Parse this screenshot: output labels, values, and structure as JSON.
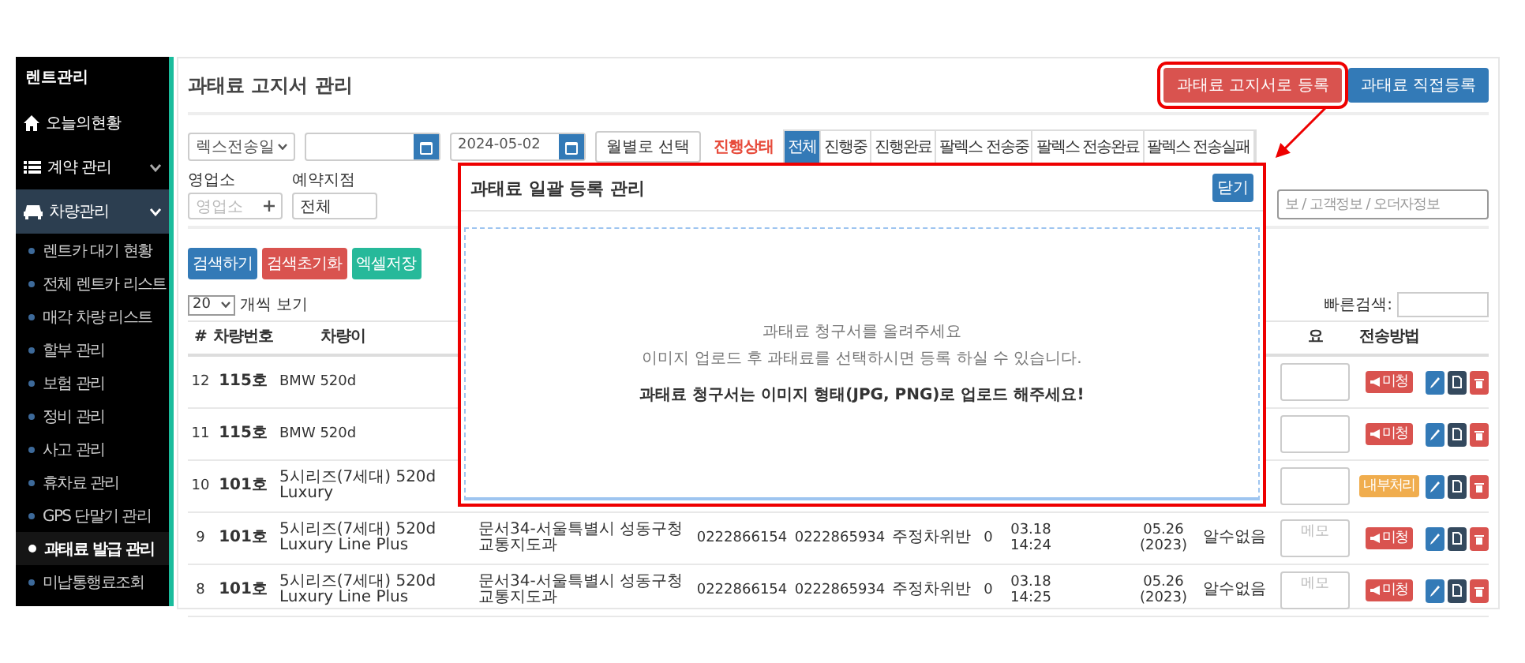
{
  "sidebar": {
    "title": "렌트관리",
    "items": [
      {
        "kind": "link",
        "label": "오늘의현황"
      },
      {
        "kind": "group",
        "label": "계약 관리",
        "expanded": false
      },
      {
        "kind": "group",
        "label": "차량관리",
        "expanded": true,
        "children": [
          {
            "label": "렌트카 대기 현황",
            "selected": false
          },
          {
            "label": "전체 렌트카 리스트",
            "selected": false
          },
          {
            "label": "매각 차량 리스트",
            "selected": false
          },
          {
            "label": "할부 관리",
            "selected": false
          },
          {
            "label": "보험 관리",
            "selected": false
          },
          {
            "label": "정비 관리",
            "selected": false
          },
          {
            "label": "사고 관리",
            "selected": false
          },
          {
            "label": "휴차료 관리",
            "selected": false
          },
          {
            "label": "GPS 단말기 관리",
            "selected": false
          },
          {
            "label": "과태료 발급 관리",
            "selected": true
          },
          {
            "label": "미납통행료조회",
            "selected": false
          }
        ]
      }
    ]
  },
  "header": {
    "title": "과태료 고지서 관리",
    "buttons": [
      {
        "label": "과태료 고지서로 등록",
        "kind": "danger",
        "highlighted": true
      },
      {
        "label": "과태료 직접등록",
        "kind": "primary",
        "highlighted": false
      }
    ]
  },
  "filters": {
    "date_type": "렉스전송일",
    "date_to": "2024-05-02",
    "month_button": "월별로 선택",
    "status_label": "진행상태",
    "status_tabs": [
      {
        "label": "전체",
        "selected": true
      },
      {
        "label": "진행중",
        "selected": false
      },
      {
        "label": "진행완료",
        "selected": false
      },
      {
        "label": "팔렉스 전송중",
        "selected": false
      },
      {
        "label": "팔렉스 전송완료",
        "selected": false
      },
      {
        "label": "팔렉스 전송실패",
        "selected": false
      }
    ],
    "branch": {
      "label": "영업소",
      "placeholder": "영업소"
    },
    "reserve_branch": {
      "label": "예약지점",
      "value": "전체"
    },
    "search": {
      "placeholder": "보 / 고객정보 / 오더자정보"
    }
  },
  "actions": [
    {
      "label": "검색하기",
      "kind": "primary"
    },
    {
      "label": "검색초기화",
      "kind": "danger"
    },
    {
      "label": "엑셀저장",
      "kind": "success"
    }
  ],
  "page_size": {
    "value": "20",
    "label": "개씩 보기"
  },
  "quick_search": {
    "label": "빠른검색:"
  },
  "table": {
    "headers": {
      "no": "#",
      "plate": "차량번호",
      "name": "차량이",
      "memo": "요",
      "send": "전송방법"
    },
    "rows": [
      {
        "no": "12",
        "plate": "115호",
        "name": "BMW 520d",
        "send": {
          "kind": "unclaimed",
          "label": "미청"
        }
      },
      {
        "no": "11",
        "plate": "115호",
        "name": "BMW 520d",
        "send": {
          "kind": "unclaimed",
          "label": "미청"
        }
      },
      {
        "no": "10",
        "plate": "101호",
        "name": "5시리즈(7세대) 520d Luxury",
        "send": {
          "kind": "internal",
          "label": "내부처리"
        }
      },
      {
        "no": "9",
        "plate": "101호",
        "name": "5시리즈(7세대) 520d Luxury Line Plus",
        "address": "문서34-서울특별시 성동구청 교통지도과",
        "phone1": "0222866154",
        "phone2": "0222865934",
        "violation": "주정차위반",
        "count": "0",
        "date": "03.18 14:24",
        "date2": "05.26 (2023)",
        "result": "알수없음",
        "memo_placeholder": "메모",
        "send": {
          "kind": "unclaimed",
          "label": "미청"
        }
      },
      {
        "no": "8",
        "plate": "101호",
        "name": "5시리즈(7세대) 520d Luxury Line Plus",
        "address": "문서34-서울특별시 성동구청 교통지도과",
        "phone1": "0222866154",
        "phone2": "0222865934",
        "violation": "주정차위반",
        "count": "0",
        "date": "03.18 14:25",
        "date2": "05.26 (2023)",
        "result": "알수없음",
        "memo_placeholder": "메모",
        "send": {
          "kind": "unclaimed",
          "label": "미청"
        }
      }
    ]
  },
  "modal": {
    "title": "과태료 일괄 등록 관리",
    "close": "닫기",
    "hints": [
      "과태료 청구서를 올려주세요",
      "이미지 업로드 후 과태료를 선택하시면 등록 하실 수 있습니다."
    ],
    "notice": "과태료 청구서는 이미지 형태(JPG, PNG)로 업로드 해주세요!"
  }
}
